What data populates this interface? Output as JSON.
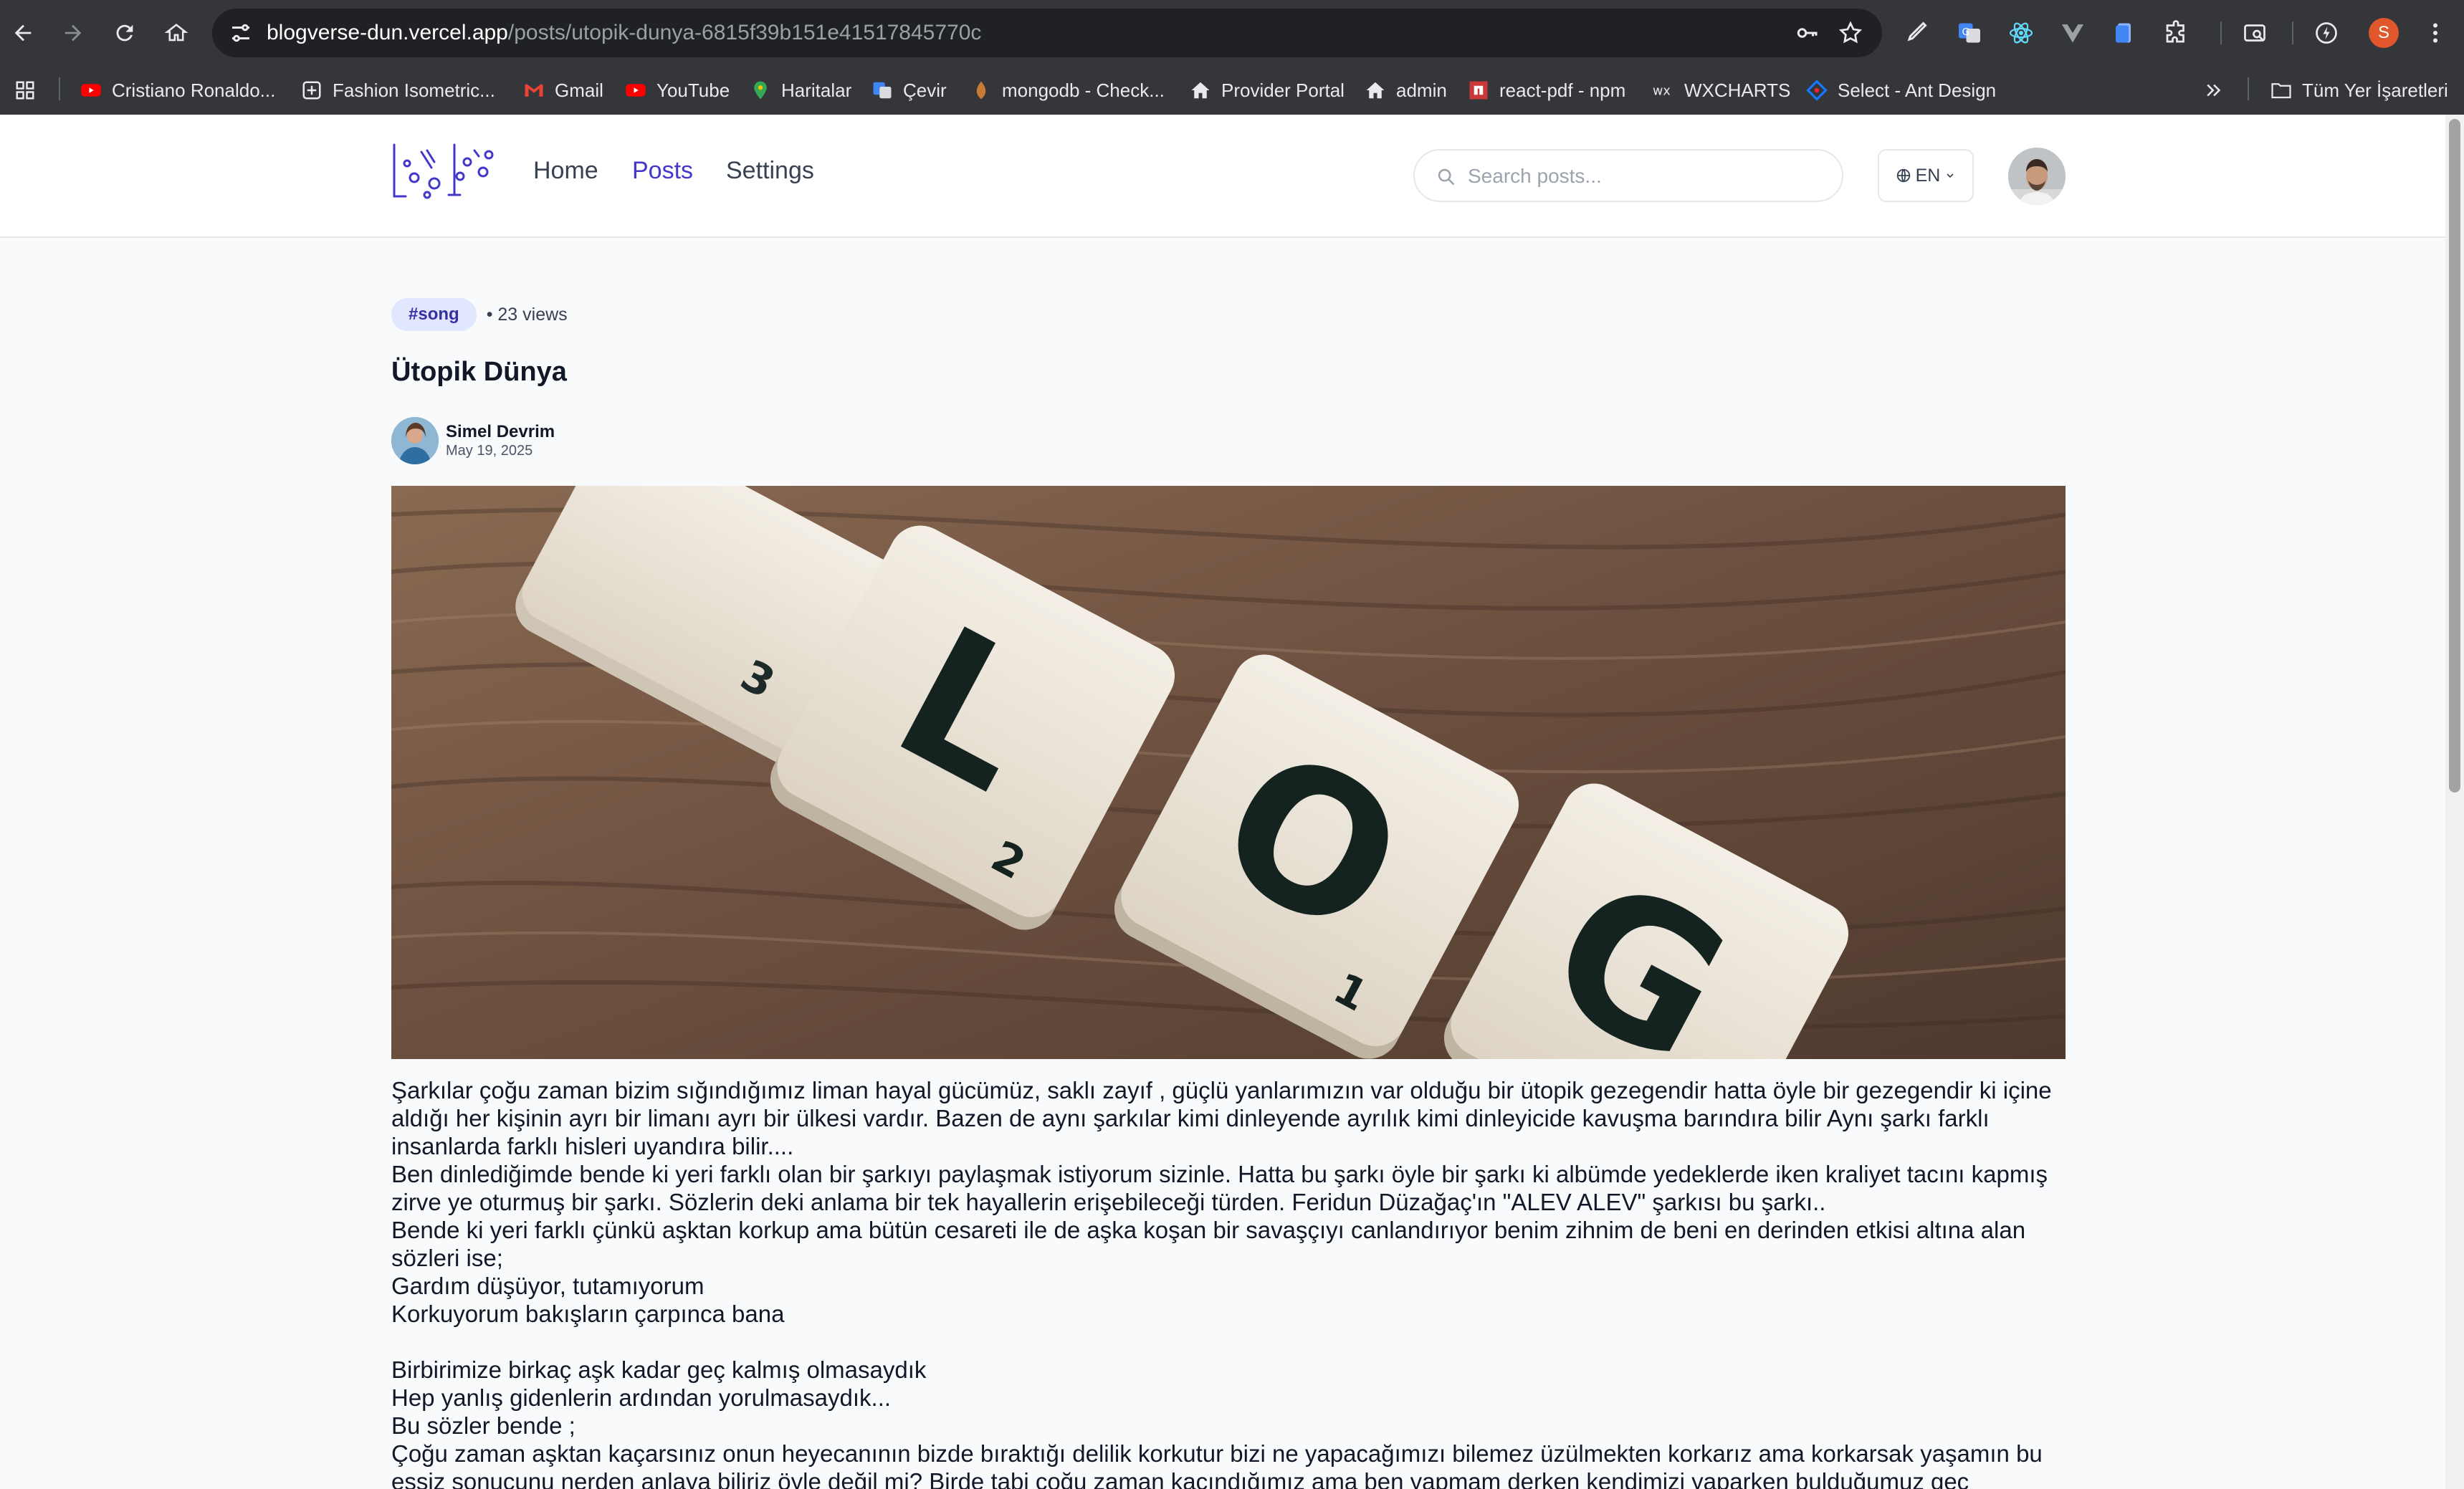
{
  "browser": {
    "url_host": "blogverse-dun.vercel.app",
    "url_path": "/posts/utopik-dunya-6815f39b151e41517845770c",
    "profile_initial": "S",
    "bookmarks": [
      {
        "label": "Cristiano Ronaldo...",
        "icon": "youtube-icon"
      },
      {
        "label": "Fashion Isometric...",
        "icon": "web-icon"
      },
      {
        "label": "Gmail",
        "icon": "gmail-icon"
      },
      {
        "label": "YouTube",
        "icon": "youtube-icon"
      },
      {
        "label": "Haritalar",
        "icon": "maps-icon"
      },
      {
        "label": "Çevir",
        "icon": "translate-icon"
      },
      {
        "label": "mongodb - Check...",
        "icon": "mongodb-icon"
      },
      {
        "label": "Provider Portal",
        "icon": "home-icon"
      },
      {
        "label": "admin",
        "icon": "home-icon"
      },
      {
        "label": "react-pdf - npm",
        "icon": "npm-icon"
      },
      {
        "label": "WXCHARTS",
        "icon": "wx-icon"
      },
      {
        "label": "Select - Ant Design",
        "icon": "antd-icon"
      }
    ],
    "all_bookmarks_label": "Tüm Yer İşaretleri"
  },
  "header": {
    "nav": [
      {
        "label": "Home",
        "active": false
      },
      {
        "label": "Posts",
        "active": true
      },
      {
        "label": "Settings",
        "active": false
      }
    ],
    "search_placeholder": "Search posts...",
    "language": "EN"
  },
  "post": {
    "tag": "#song",
    "views": "• 23 views",
    "title": "Ütopik Dünya",
    "author_name": "Simel Devrim",
    "date": "May 19, 2025",
    "image_tiles": [
      "L",
      "O",
      "G"
    ],
    "paragraphs": [
      "Şarkılar çoğu zaman bizim sığındığımız liman hayal gücümüz, saklı zayıf , güçlü yanlarımızın var olduğu bir ütopik gezegendir hatta öyle bir gezegendir ki içine aldığı her kişinin ayrı bir limanı ayrı bir ülkesi vardır. Bazen de aynı şarkılar kimi dinleyende ayrılık kimi dinleyicide kavuşma barındıra bilir Aynı şarkı farklı insanlarda farklı hisleri uyandıra bilir....",
      "Ben dinlediğimde bende ki yeri farklı olan bir şarkıyı paylaşmak istiyorum sizinle. Hatta bu şarkı öyle bir şarkı ki albümde yedeklerde iken kraliyet tacını kapmış zirve ye oturmuş bir şarkı. Sözlerin deki anlama bir tek hayallerin erişebileceği türden. Feridun Düzağaç'ın \"ALEV ALEV\" şarkısı bu şarkı..",
      "Bende ki yeri farklı çünkü aşktan korkup ama bütün cesareti ile de aşka koşan bir savaşçıyı canlandırıyor benim zihnim de beni en derinden etkisi altına alan sözleri ise;",
      "Gardım düşüyor, tutamıyorum",
      "Korkuyorum bakışların çarpınca bana",
      " ",
      "Birbirimize birkaç aşk kadar geç kalmış olmasaydık",
      "Hep yanlış gidenlerin ardından yorulmasaydık...",
      "Bu sözler bende ;",
      "Çoğu zaman aşktan kaçarsınız onun heyecanının bizde bıraktığı delilik korkutur bizi ne yapacağımızı bilemez üzülmekten korkarız ama korkarsak yaşamın bu eşsiz sonucunu nerden anlaya biliriz öyle değil mi? Birde tabi çoğu zaman kaçındığımız ama ben yapmam derken kendimizi yaparken bulduğumuz geç"
    ]
  }
}
